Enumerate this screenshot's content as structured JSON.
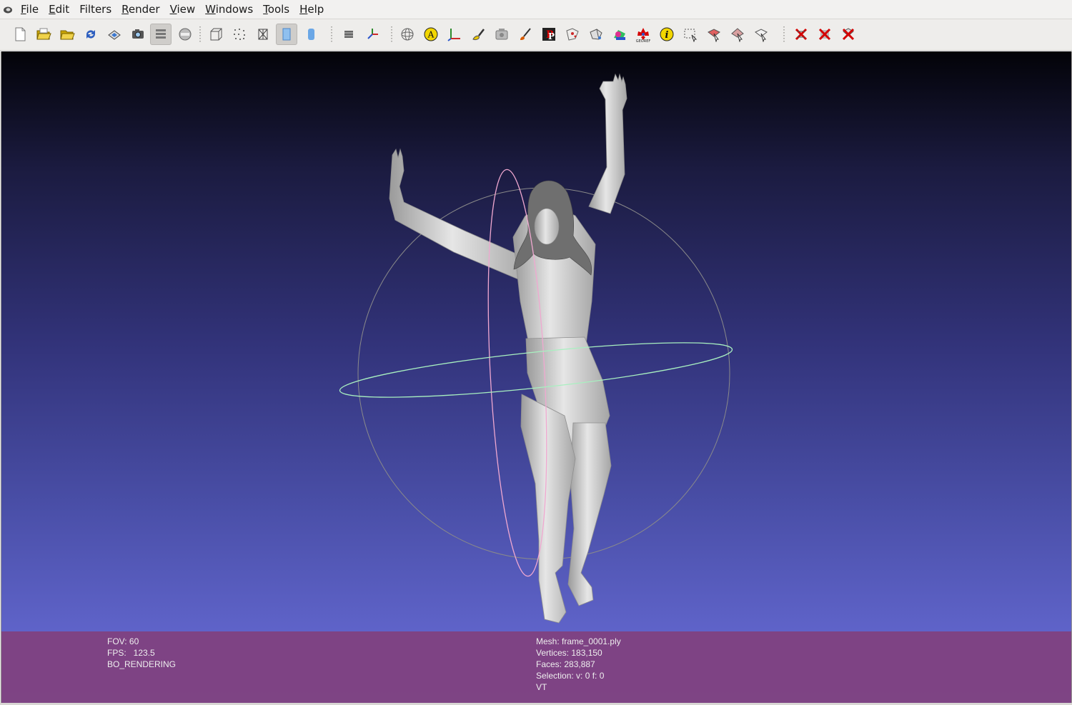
{
  "menubar": {
    "items": [
      {
        "accel": "F",
        "rest": "ile"
      },
      {
        "accel": "E",
        "rest": "dit"
      },
      {
        "accel": "",
        "rest": "Filters"
      },
      {
        "accel": "R",
        "rest": "ender"
      },
      {
        "accel": "V",
        "rest": "iew"
      },
      {
        "accel": "W",
        "rest": "indows"
      },
      {
        "accel": "T",
        "rest": "ools"
      },
      {
        "accel": "H",
        "rest": "elp"
      }
    ]
  },
  "toolbar": {
    "icons": [
      "new-project-icon",
      "open-project-icon",
      "import-mesh-icon",
      "reload-icon",
      "export-mesh-icon",
      "snapshot-icon",
      "layers-icon",
      "raster-icon",
      "bounding-box-icon",
      "points-render-icon",
      "wireframe-render-icon",
      "flat-render-icon",
      "smooth-render-icon",
      "color-icon",
      "axes-icon",
      "trackball-icon",
      "annotation-icon",
      "measure-icon",
      "paint-brush-icon",
      "align-icon",
      "paint-icon",
      "pickpoints-icon",
      "select-vertices-icon",
      "select-faces-icon",
      "texture-icon",
      "georef-icon",
      "info-icon",
      "select-rect-icon",
      "select-paint-icon",
      "select-zpaint-icon",
      "select-connected-icon",
      "delete-vertices-icon",
      "delete-faces-icon",
      "delete-selection-icon"
    ],
    "accent_yellow": "#f2d600",
    "accent_red": "#d40000"
  },
  "viewport": {
    "mesh_color": "#cfcfcf",
    "trackball_colors": {
      "sphere": "#8a8a8a",
      "horizontal": "#a8f0c0",
      "vertical": "#f0a8d0"
    }
  },
  "info": {
    "left": [
      "FOV: 60",
      "FPS:   123.5",
      "BO_RENDERING"
    ],
    "right": [
      "Mesh: frame_0001.ply",
      "Vertices: 183,150",
      "Faces: 283,887",
      "Selection: v: 0 f: 0",
      "VT"
    ]
  }
}
